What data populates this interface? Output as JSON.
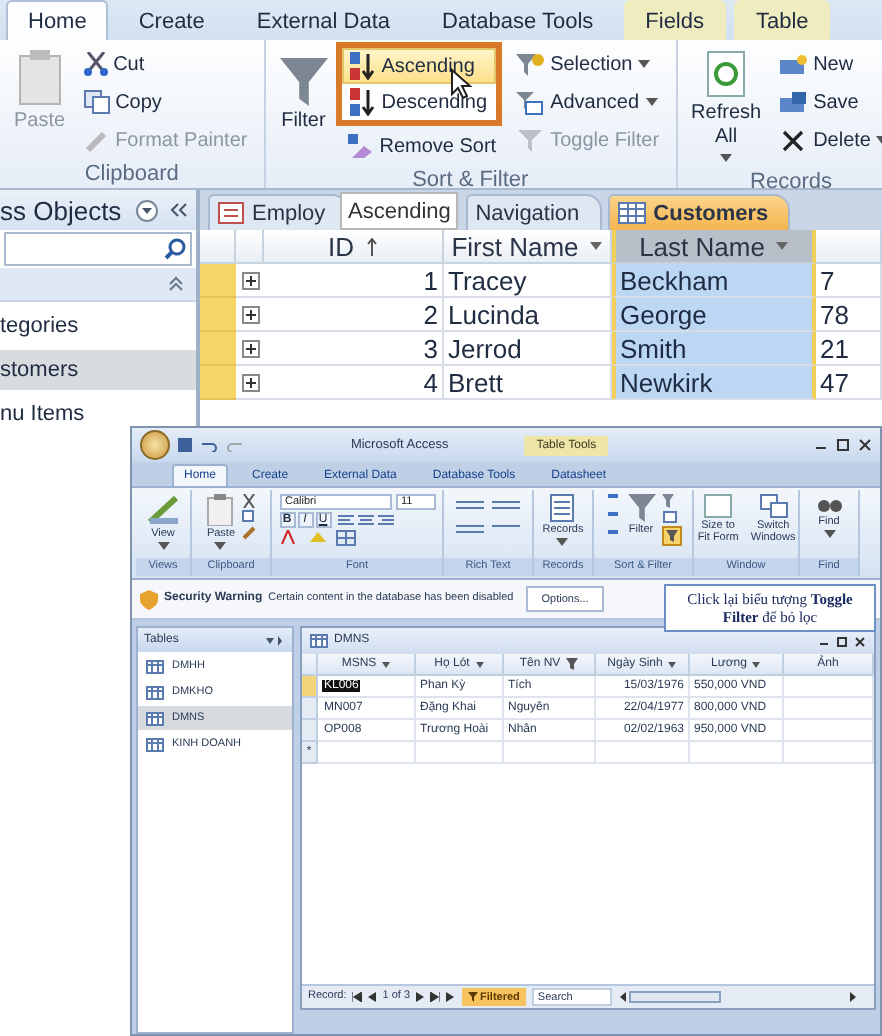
{
  "ribbon_2010": {
    "tabs": [
      {
        "label": "Home",
        "selected": true,
        "contextual": false
      },
      {
        "label": "Create",
        "selected": false,
        "contextual": false
      },
      {
        "label": "External Data",
        "selected": false,
        "contextual": false
      },
      {
        "label": "Database Tools",
        "selected": false,
        "contextual": false
      },
      {
        "label": "Fields",
        "selected": false,
        "contextual": true
      },
      {
        "label": "Table",
        "selected": false,
        "contextual": true
      }
    ],
    "clipboard": {
      "paste": {
        "label": "Paste",
        "disabled": true
      },
      "items": [
        {
          "label": "Cut",
          "disabled": false
        },
        {
          "label": "Copy",
          "disabled": false
        },
        {
          "label": "Format Painter",
          "disabled": true
        }
      ],
      "label": "Clipboard"
    },
    "sort_filter": {
      "filter": "Filter",
      "sort_buttons": [
        {
          "label": "Ascending",
          "highlighted": true
        },
        {
          "label": "Descending",
          "highlighted": false
        },
        {
          "label": "Remove Sort",
          "highlighted": false
        }
      ],
      "filter_buttons": [
        {
          "label": "Selection",
          "dropdown": true,
          "disabled": false
        },
        {
          "label": "Advanced",
          "dropdown": true,
          "disabled": false
        },
        {
          "label": "Toggle Filter",
          "dropdown": false,
          "disabled": true
        }
      ],
      "label": "Sort & Filter"
    },
    "records": {
      "refresh": "Refresh All",
      "items": [
        {
          "label": "New",
          "dropdown": false
        },
        {
          "label": "Save",
          "dropdown": false
        },
        {
          "label": "Delete",
          "dropdown": true
        }
      ],
      "label": "Records"
    }
  },
  "navigation_pane": {
    "title": "ss Objects",
    "items": [
      {
        "label": "tegories",
        "selected": false
      },
      {
        "label": "stomers",
        "selected": true
      },
      {
        "label": "nu Items",
        "selected": false
      }
    ]
  },
  "document_tabs": [
    {
      "label": "Employ",
      "selected": false,
      "kind": "form"
    },
    {
      "label": "Navigation",
      "selected": false,
      "kind": "plain"
    },
    {
      "label": "Customers",
      "selected": true,
      "kind": "table"
    }
  ],
  "tooltip": "Ascending",
  "datasheet": {
    "columns": [
      {
        "label": "ID",
        "selected": false,
        "kind": "sorted"
      },
      {
        "label": "First Name",
        "selected": false,
        "kind": "dropdown"
      },
      {
        "label": "Last Name",
        "selected": true,
        "kind": "dropdown"
      }
    ],
    "rows": [
      {
        "cells": [
          "1",
          "Tracey",
          "Beckham",
          "7"
        ]
      },
      {
        "cells": [
          "2",
          "Lucinda",
          "George",
          "78"
        ]
      },
      {
        "cells": [
          "3",
          "Jerrod",
          "Smith",
          "21"
        ]
      },
      {
        "cells": [
          "4",
          "Brett",
          "Newkirk",
          "47"
        ]
      }
    ]
  },
  "access_2007": {
    "title": "Microsoft Access",
    "contextual_title": "Table Tools",
    "tabs": [
      {
        "label": "Home",
        "selected": true
      },
      {
        "label": "Create",
        "selected": false
      },
      {
        "label": "External Data",
        "selected": false
      },
      {
        "label": "Database Tools",
        "selected": false
      },
      {
        "label": "Datasheet",
        "selected": false
      }
    ],
    "ribbon_groups": [
      {
        "label": "Views",
        "kind": "views",
        "buttons": [
          "View"
        ]
      },
      {
        "label": "Clipboard",
        "kind": "clipboard",
        "buttons": [
          "Paste"
        ]
      },
      {
        "label": "Font",
        "kind": "font",
        "font_name": "Calibri",
        "font_size": "11",
        "format_buttons": [
          "B",
          "I",
          "U"
        ]
      },
      {
        "label": "Rich Text",
        "kind": "rich_text"
      },
      {
        "label": "Records",
        "kind": "records",
        "buttons": [
          "Records"
        ]
      },
      {
        "label": "Sort & Filter",
        "kind": "sort_filter",
        "buttons": [
          "Filter"
        ]
      },
      {
        "label": "Window",
        "kind": "window",
        "buttons": [
          "Size to Fit Form",
          "Switch Windows"
        ]
      },
      {
        "label": "Find",
        "kind": "find",
        "buttons": [
          "Find"
        ]
      }
    ],
    "security_warning": {
      "title": "Security Warning",
      "message": "Certain content in the database has been disabled",
      "button": "Options..."
    },
    "callout": "Click lại biểu tượng **Toggle Filter** để bỏ lọc",
    "navigation_pane": {
      "title": "Tables",
      "items": [
        {
          "label": "DMHH",
          "selected": false
        },
        {
          "label": "DMKHO",
          "selected": false
        },
        {
          "label": "DMNS",
          "selected": true
        },
        {
          "label": "KINH DOANH",
          "selected": false
        }
      ]
    },
    "table_window": {
      "title": "DMNS",
      "columns": [
        {
          "label": "MSNS",
          "kind": "dropdown",
          "numeric": false
        },
        {
          "label": "Họ Lót",
          "kind": "dropdown",
          "numeric": false
        },
        {
          "label": "Tên NV",
          "kind": "filtered",
          "numeric": false
        },
        {
          "label": "Ngày Sinh",
          "kind": "dropdown",
          "numeric": true
        },
        {
          "label": "Lương",
          "kind": "dropdown",
          "numeric": false
        },
        {
          "label": "Ảnh",
          "kind": "none"
        }
      ],
      "rows": [
        {
          "selected": true,
          "cells": [
            "KL006",
            "Phan Kỳ",
            "Tích",
            "15/03/1976",
            "550,000 VND"
          ]
        },
        {
          "selected": false,
          "cells": [
            "MN007",
            "Đặng Khai",
            "Nguyên",
            "22/04/1977",
            "800,000 VND"
          ]
        },
        {
          "selected": false,
          "cells": [
            "OP008",
            "Trương Hoài",
            "Nhân",
            "02/02/1963",
            "950,000 VND"
          ]
        }
      ],
      "new_row_marker": "*",
      "record_nav": {
        "label": "Record:",
        "position": "1 of 3",
        "filter_status": "Filtered",
        "search_placeholder": "Search"
      }
    }
  }
}
